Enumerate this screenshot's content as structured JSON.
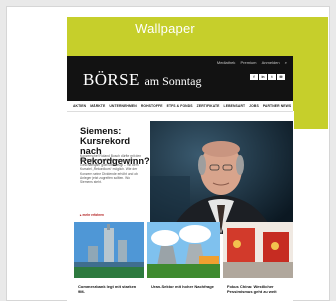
{
  "banner": {
    "label": "Wallpaper",
    "color": "#c6cf2b"
  },
  "site": {
    "brand_main": "BÖRSE",
    "brand_sub": "am Sonntag",
    "top_links": [
      "Mediathek",
      "Premium",
      "Anmelden",
      "⌕"
    ],
    "apps": [
      "f",
      "in",
      "t",
      "✉"
    ],
    "nav": [
      "AKTIEN",
      "MÄRKTE",
      "UNTERNEHMEN",
      "ROHSTOFFE",
      "ETFS & FONDS",
      "ZERTIFIKATE",
      "LEBENSART",
      "JOBS",
      "PARTNER NEWS"
    ],
    "hero": {
      "title": "Siemens: Kursrekord nach Rekordgewinn?",
      "desc": "Konzernchef Roland Busch dürfte mit den Ergebnissen der Münchner im ersten Geschäftsjahr glatt überzeugt – mit dem Kursziel „Rekordkurs“ möglich. Wie der Konzern seine Dividende erhöht und ob Anleger jetzt zugreifen sollten. Wo Siemens steht.",
      "more": "▸ mehr erfahren"
    },
    "cards": [
      {
        "caption": "Commerzbank legt mit starken 9M-"
      },
      {
        "caption": "Uran-Sektor mit hoher Nachfrage"
      },
      {
        "caption": "Fokus China: Westlicher Pessimismus geht zu weit"
      }
    ]
  }
}
